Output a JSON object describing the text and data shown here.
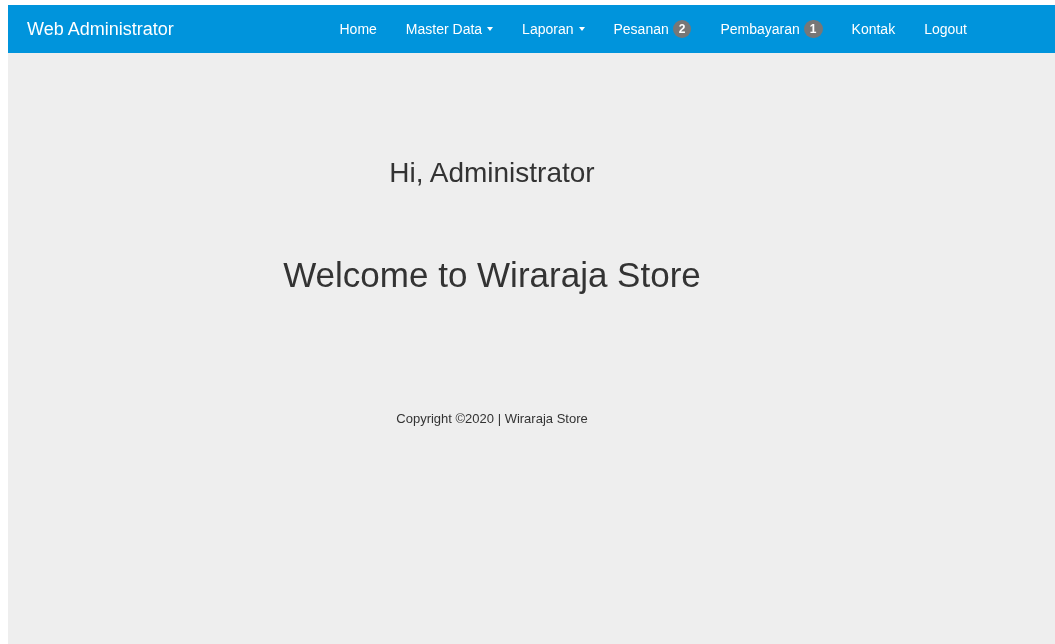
{
  "navbar": {
    "brand": "Web Administrator",
    "items": [
      {
        "label": "Home",
        "kind": "link"
      },
      {
        "label": "Master Data",
        "kind": "dropdown"
      },
      {
        "label": "Laporan",
        "kind": "dropdown"
      },
      {
        "label": "Pesanan",
        "kind": "badge",
        "badge": "2"
      },
      {
        "label": "Pembayaran",
        "kind": "badge",
        "badge": "1"
      },
      {
        "label": "Kontak",
        "kind": "link"
      },
      {
        "label": "Logout",
        "kind": "link"
      }
    ]
  },
  "greeting": "Hi, Administrator",
  "headline": "Welcome to Wiraraja Store",
  "footer": "Copyright ©2020 | Wiraraja Store"
}
